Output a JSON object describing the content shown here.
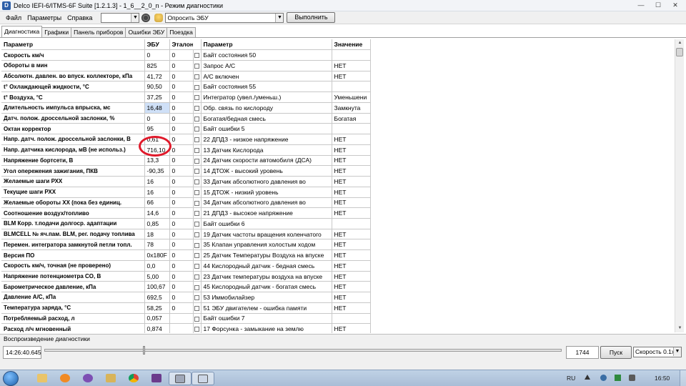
{
  "window": {
    "title": "Delco IEFI-6/ITMS-6F Suite [1.2.1.3] - 1_6__2_0_n - Режим диагностики",
    "icon": "app-icon",
    "buttons": {
      "minimize": "—",
      "maximize": "☐",
      "close": "✕"
    }
  },
  "menu": {
    "items": [
      "Файл",
      "Параметры",
      "Справка"
    ],
    "port_dropdown_value": "",
    "action_dropdown_value": "Опросить ЭБУ",
    "run_button": "Выполнить"
  },
  "tabs": [
    {
      "label": "Диагностика",
      "active": true
    },
    {
      "label": "Графики",
      "active": false
    },
    {
      "label": "Панель приборов",
      "active": false
    },
    {
      "label": "Ошибки ЭБУ",
      "active": false
    },
    {
      "label": "Поездка",
      "active": false
    }
  ],
  "left_table": {
    "headers": [
      "Параметр",
      "ЭБУ",
      "Эталон"
    ],
    "rows": [
      {
        "name": "Скорость км/ч",
        "ecu": "0",
        "ref": "0"
      },
      {
        "name": "Обороты в мин",
        "ecu": "825",
        "ref": "0"
      },
      {
        "name": "Абсолютн. давлен. во впуск. коллекторе, кПа",
        "ecu": "41,72",
        "ref": "0"
      },
      {
        "name": "t° Охлаждающей жидкости, °C",
        "ecu": "90,50",
        "ref": "0"
      },
      {
        "name": "t° Воздуха, °C",
        "ecu": "37,25",
        "ref": "0"
      },
      {
        "name": "Длительность импульса впрыска, мс",
        "ecu": "16,48",
        "ref": "0",
        "highlighted": true
      },
      {
        "name": "Датч. полож. дроссельной заслонки, %",
        "ecu": "0",
        "ref": "0"
      },
      {
        "name": "Октан корректор",
        "ecu": "95",
        "ref": "0"
      },
      {
        "name": "Напр. датч. полож. дроссельной заслонки, В",
        "ecu": "0,61",
        "ref": "0"
      },
      {
        "name": "Напр. датчика кислорода, мВ (не использ.)",
        "ecu": "716,10",
        "ref": "0"
      },
      {
        "name": "Напряжение бортсети, В",
        "ecu": "13,3",
        "ref": "0"
      },
      {
        "name": "Угол опережения зажигания, ПКВ",
        "ecu": "-90,35",
        "ref": "0"
      },
      {
        "name": "Желаемые шаги РХХ",
        "ecu": "16",
        "ref": "0"
      },
      {
        "name": "Текущие шаги РХХ",
        "ecu": "16",
        "ref": "0"
      },
      {
        "name": "Желаемые обороты ХХ (пока без единиц.",
        "ecu": "66",
        "ref": "0"
      },
      {
        "name": "Соотношение воздух/топливо",
        "ecu": "14,6",
        "ref": "0"
      },
      {
        "name": "BLM Корр. т.подачи долгоср. адаптации",
        "ecu": "0,85",
        "ref": "0"
      },
      {
        "name": "BLMCELL № яч.пам. BLM, рег. подачу топлива",
        "ecu": "18",
        "ref": "0"
      },
      {
        "name": "Перемен. интегратора замкнутой петли топл.",
        "ecu": "78",
        "ref": "0"
      },
      {
        "name": "Версия ПО",
        "ecu": "0x180F",
        "ref": "0"
      },
      {
        "name": "Скорость км/ч, точная (не проверено)",
        "ecu": "0,0",
        "ref": "0"
      },
      {
        "name": "Напряжение потенциометра CO, В",
        "ecu": "5,00",
        "ref": "0"
      },
      {
        "name": "Барометрическое давление, кПа",
        "ecu": "100,67",
        "ref": "0"
      },
      {
        "name": "Давление А/С, кПа",
        "ecu": "692,5",
        "ref": "0"
      },
      {
        "name": "Температура заряда, °C",
        "ecu": "58,25",
        "ref": "0"
      },
      {
        "name": "Потребляемый расход, л",
        "ecu": "0,057",
        "ref": ""
      },
      {
        "name": "Расход л/ч мгновенный",
        "ecu": "0,874",
        "ref": ""
      }
    ]
  },
  "right_table": {
    "headers": [
      "Параметр",
      "Значение"
    ],
    "rows": [
      {
        "name": "Байт состояния 50",
        "value": ""
      },
      {
        "name": "Запрос А/С",
        "value": "НЕТ"
      },
      {
        "name": "А/С включен",
        "value": "НЕТ"
      },
      {
        "name": "Байт состояния 55",
        "value": ""
      },
      {
        "name": "Интегратор (увел./уменьш.)",
        "value": "Уменьшени"
      },
      {
        "name": "Обр. связь по кислороду",
        "value": "Замкнута"
      },
      {
        "name": "Богатая/бедная смесь",
        "value": "Богатая"
      },
      {
        "name": "Байт ошибки 5",
        "value": ""
      },
      {
        "name": "22 ДПДЗ - низкое напряжение",
        "value": "НЕТ"
      },
      {
        "name": "13 Датчик Кислорода",
        "value": "НЕТ"
      },
      {
        "name": "24 Датчик скорости автомобиля (ДСА)",
        "value": "НЕТ"
      },
      {
        "name": "14 ДТОЖ - высокий уровень",
        "value": "НЕТ"
      },
      {
        "name": "33 Датчик абсолютного давления во",
        "value": "НЕТ"
      },
      {
        "name": "15 ДТОЖ - низкий уровень",
        "value": "НЕТ"
      },
      {
        "name": "34 Датчик абсолютного давления во",
        "value": "НЕТ"
      },
      {
        "name": "21 ДПДЗ - высокое напряжение",
        "value": "НЕТ"
      },
      {
        "name": "Байт ошибки 6",
        "value": ""
      },
      {
        "name": "19 Датчик частоты вращения коленчатого",
        "value": "НЕТ"
      },
      {
        "name": "35 Клапан управления холостым ходом",
        "value": "НЕТ"
      },
      {
        "name": "25 Датчик Температуры Воздуха на впуске",
        "value": "НЕТ"
      },
      {
        "name": "44 Кислородный датчик - бедная смесь",
        "value": "НЕТ"
      },
      {
        "name": "23 Датчик температуры воздуха на впуске",
        "value": "НЕТ"
      },
      {
        "name": "45 Кислородный датчик - богатая смесь",
        "value": "НЕТ"
      },
      {
        "name": "53 Иммобилайзер",
        "value": "НЕТ"
      },
      {
        "name": "51 ЭБУ двигателем - ошибка памяти",
        "value": "НЕТ"
      },
      {
        "name": "Байт ошибки 7",
        "value": ""
      },
      {
        "name": "17 Форсунка - замыкание на землю",
        "value": "НЕТ"
      }
    ]
  },
  "playback": {
    "label": "Воспроизведение диагностики",
    "time": "14:26:40.645",
    "position_fraction": 0.19,
    "record_count": "1744",
    "start_button": "Пуск",
    "speed_value": "Скорость 0.1x"
  },
  "taskbar": {
    "apps": [
      "windows-explorer-icon",
      "media-player-icon",
      "viber-icon",
      "chrome-icon",
      "winrar-icon",
      "delco-suite-icon",
      "notepad-icon"
    ],
    "language": "RU",
    "clock": "16:50"
  },
  "colors": {
    "highlight": "#cfe0f7",
    "annotation_circle": "#e0192a",
    "taskbar": "#b3c6dd"
  }
}
